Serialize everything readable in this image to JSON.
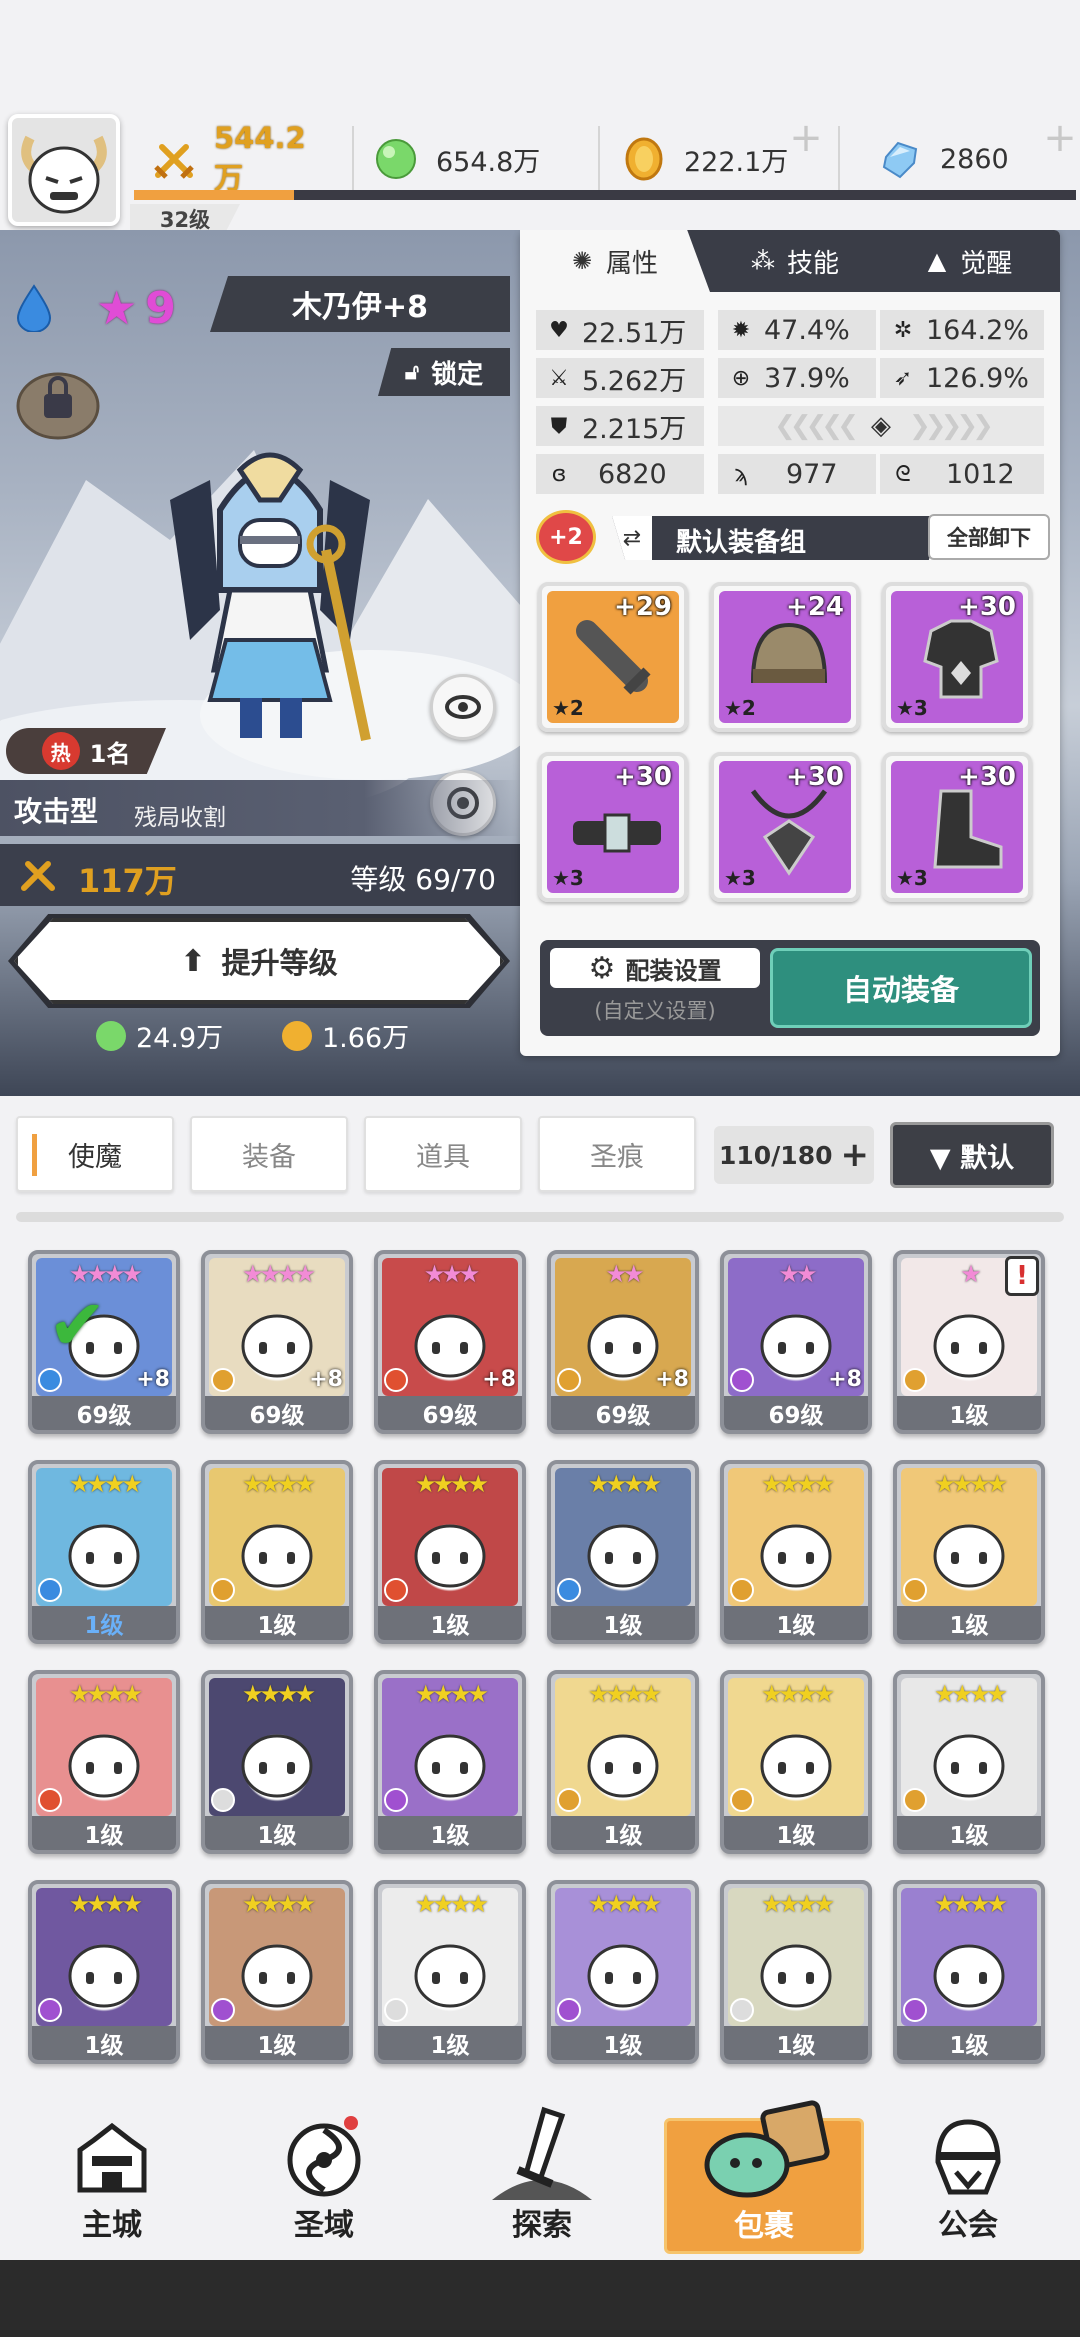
{
  "top": {
    "level": "32级",
    "combat_power": "544.2万",
    "green_currency": "654.8万",
    "gold": "222.1万",
    "diamonds": "2860",
    "xp_fraction": 0.17
  },
  "hero": {
    "star_count": "9",
    "name": "木乃伊+8",
    "lock_label": "锁定",
    "rank_badge": "热",
    "rank": "1名",
    "type": "攻击型",
    "subtype": "残局收割",
    "power": "117万",
    "level_text": "等级 69/70",
    "upgrade_label": "提升等级",
    "cost_green": "24.9万",
    "cost_gold": "1.66万"
  },
  "panel": {
    "tabs": [
      "属性",
      "技能",
      "觉醒"
    ],
    "stats": {
      "hp": "22.51万",
      "crit": "47.4%",
      "crit_dmg": "164.2%",
      "atk": "5.262万",
      "acc": "37.9%",
      "speed": "126.9%",
      "def": "2.215万",
      "s1": "6820",
      "s2": "977",
      "s3": "1012"
    },
    "set_badge": "+2",
    "set_name": "默认装备组",
    "unequip_all": "全部卸下",
    "equipment": [
      {
        "plus": "+29",
        "stars": "★2",
        "slot": "weapon"
      },
      {
        "plus": "+24",
        "stars": "★2",
        "slot": "helmet"
      },
      {
        "plus": "+30",
        "stars": "★3",
        "slot": "armor"
      },
      {
        "plus": "+30",
        "stars": "★3",
        "slot": "belt"
      },
      {
        "plus": "+30",
        "stars": "★3",
        "slot": "necklace"
      },
      {
        "plus": "+30",
        "stars": "★3",
        "slot": "boots"
      }
    ],
    "config_label": "配装设置",
    "config_sub": "(自定义设置)",
    "auto_equip": "自动装备"
  },
  "inventory": {
    "tabs": [
      "使魔",
      "装备",
      "道具",
      "圣痕"
    ],
    "count": "110/180",
    "sort_label": "▼ 默认",
    "cards": [
      {
        "level": "69级",
        "plus": "+8",
        "stars": "★★★★",
        "pink": true,
        "color": "#6b8fd8",
        "element": "#3a8be0",
        "checked": true
      },
      {
        "level": "69级",
        "plus": "+8",
        "stars": "★★★★",
        "pink": true,
        "color": "#e8dcc0",
        "element": "#e0a030"
      },
      {
        "level": "69级",
        "plus": "+8",
        "stars": "★★★",
        "pink": true,
        "color": "#c84b4b",
        "element": "#e05030"
      },
      {
        "level": "69级",
        "plus": "+8",
        "stars": "★★",
        "pink": true,
        "color": "#d8a850",
        "element": "#e0a030"
      },
      {
        "level": "69级",
        "plus": "+8",
        "stars": "★★",
        "pink": true,
        "color": "#8d6cc8",
        "element": "#a050d0"
      },
      {
        "level": "1级",
        "plus": "",
        "stars": "★",
        "pink": true,
        "color": "#f2e8e8",
        "element": "#e0a030",
        "alert": "!"
      },
      {
        "level": "1级",
        "plus": "",
        "stars": "★★★★",
        "pink": false,
        "color": "#6fb8e0",
        "element": "#3a8be0",
        "bluelevel": true
      },
      {
        "level": "1级",
        "plus": "",
        "stars": "★★★★",
        "pink": false,
        "color": "#e8c870",
        "element": "#e0a030"
      },
      {
        "level": "1级",
        "plus": "",
        "stars": "★★★★",
        "pink": false,
        "color": "#c04848",
        "element": "#e05030"
      },
      {
        "level": "1级",
        "plus": "",
        "stars": "★★★★",
        "pink": false,
        "color": "#6a7fa8",
        "element": "#3a8be0"
      },
      {
        "level": "1级",
        "plus": "",
        "stars": "★★★★",
        "pink": false,
        "color": "#f0c878",
        "element": "#e0a030"
      },
      {
        "level": "1级",
        "plus": "",
        "stars": "★★★★",
        "pink": false,
        "color": "#f0c878",
        "element": "#e0a030"
      },
      {
        "level": "1级",
        "plus": "",
        "stars": "★★★★",
        "pink": false,
        "color": "#e89090",
        "element": "#e05030"
      },
      {
        "level": "1级",
        "plus": "",
        "stars": "★★★★",
        "pink": false,
        "color": "#4c4870",
        "element": "#dddddd"
      },
      {
        "level": "1级",
        "plus": "",
        "stars": "★★★★",
        "pink": false,
        "color": "#9a70c8",
        "element": "#a050d0"
      },
      {
        "level": "1级",
        "plus": "",
        "stars": "★★★★",
        "pink": false,
        "color": "#f0d890",
        "element": "#e0a030"
      },
      {
        "level": "1级",
        "plus": "",
        "stars": "★★★★",
        "pink": false,
        "color": "#f0d890",
        "element": "#e0a030"
      },
      {
        "level": "1级",
        "plus": "",
        "stars": "★★★★",
        "pink": false,
        "color": "#e8e8e8",
        "element": "#e0a030"
      },
      {
        "level": "1级",
        "plus": "",
        "stars": "★★★★",
        "pink": false,
        "color": "#7058a0",
        "element": "#a050d0"
      },
      {
        "level": "1级",
        "plus": "",
        "stars": "★★★★",
        "pink": false,
        "color": "#c89878",
        "element": "#a050d0"
      },
      {
        "level": "1级",
        "plus": "",
        "stars": "★★★★",
        "pink": false,
        "color": "#ececec",
        "element": "#dddddd"
      },
      {
        "level": "1级",
        "plus": "",
        "stars": "★★★★",
        "pink": false,
        "color": "#a890d8",
        "element": "#a050d0"
      },
      {
        "level": "1级",
        "plus": "",
        "stars": "★★★★",
        "pink": false,
        "color": "#d8d8c0",
        "element": "#dddddd"
      },
      {
        "level": "1级",
        "plus": "",
        "stars": "★★★★",
        "pink": false,
        "color": "#9a80d0",
        "element": "#a050d0"
      }
    ]
  },
  "nav": [
    "主城",
    "圣域",
    "探索",
    "包裹",
    "公会"
  ],
  "colors": {
    "accent": "#f0a040",
    "dark": "#3a3d47",
    "teal": "#2e8f7e"
  }
}
